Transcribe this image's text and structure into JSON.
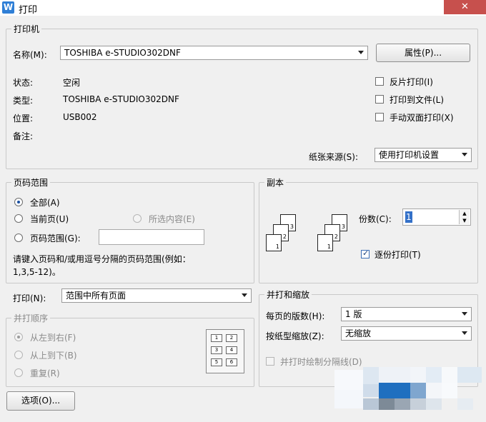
{
  "window": {
    "title": "打印",
    "app_icon": "W",
    "close_glyph": "✕"
  },
  "printer": {
    "group_title": "打印机",
    "name_label": "名称(M):",
    "name_value": "TOSHIBA e-STUDIO302DNF",
    "properties_button": "属性(P)...",
    "status_label": "状态:",
    "status_value": "空闲",
    "type_label": "类型:",
    "type_value": "TOSHIBA e-STUDIO302DNF",
    "location_label": "位置:",
    "location_value": "USB002",
    "comment_label": "备注:",
    "reverse_print": "反片打印(I)",
    "print_to_file": "打印到文件(L)",
    "manual_duplex": "手动双面打印(X)",
    "paper_source_label": "纸张来源(S):",
    "paper_source_value": "使用打印机设置"
  },
  "page_range": {
    "group_title": "页码范围",
    "all": "全部(A)",
    "current": "当前页(U)",
    "selection": "所选内容(E)",
    "pages": "页码范围(G):",
    "pages_value": "",
    "hint_line1": "请键入页码和/或用逗号分隔的页码范围(例如：",
    "hint_line2": "1,3,5-12)。"
  },
  "copies": {
    "group_title": "副本",
    "count_label": "份数(C):",
    "count_value": "1",
    "collate": "逐份打印(T)",
    "stack_a": [
      "3",
      "2",
      "1"
    ],
    "stack_b": [
      "3",
      "2",
      "1"
    ]
  },
  "print_what": {
    "label": "打印(N):",
    "value": "范围中所有页面"
  },
  "order": {
    "group_title": "并打顺序",
    "left_right": "从左到右(F)",
    "top_bottom": "从上到下(B)",
    "repeat": "重复(R)",
    "grid": [
      "1",
      "2",
      "3",
      "4",
      "5",
      "6"
    ]
  },
  "zoom": {
    "group_title": "并打和缩放",
    "pages_per_sheet_label": "每页的版数(H):",
    "pages_per_sheet_value": "1 版",
    "scale_label": "按纸型缩放(Z):",
    "scale_value": "无缩放",
    "draw_borders": "并打时绘制分隔线(D)"
  },
  "footer": {
    "options_button": "选项(O)..."
  },
  "colors": {
    "close": "#c7504d",
    "app_icon": "#2f7fd6",
    "pixel_blue": "#1f6fbf"
  }
}
